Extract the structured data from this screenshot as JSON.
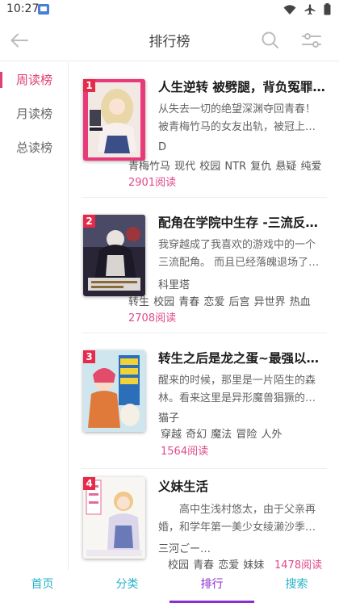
{
  "status_bar": {
    "time": "10:27"
  },
  "header": {
    "title": "排行榜"
  },
  "sidebar": {
    "items": [
      {
        "label": "周读榜",
        "active": true
      },
      {
        "label": "月读榜",
        "active": false
      },
      {
        "label": "总读榜",
        "active": false
      }
    ]
  },
  "list": [
    {
      "rank": "1",
      "title": "人生逆转 被劈腿，背负冤罪…",
      "desc": "从失去一切的绝望深渊夺回青春！被青梅竹马的女友出轨，被冠上…",
      "author": "D",
      "tags": "青梅竹马 现代 校园 NTR 复仇 悬疑 纯爱",
      "reads": "2901阅读"
    },
    {
      "rank": "2",
      "title": "配角在学院中生存 -三流反…",
      "desc": "我穿越成了我喜欢的游戏中的一个三流配角。 而且已经落魄退场了…",
      "author": "科里塔",
      "tags": "转生 校园 青春 恋爱 后宫 异世界 热血",
      "reads": "2708阅读"
    },
    {
      "rank": "3",
      "title": "转生之后是龙之蛋~最强以…",
      "desc": "醒来的时候，那里是一片陌生的森林。看来这里是异形魔兽猖獗的…",
      "author": "猫子",
      "tags": "穿越 奇幻 魔法 冒险 人外",
      "reads": "1564阅读"
    },
    {
      "rank": "4",
      "title": "义妹生活",
      "desc": "　　高中生浅村悠太，由于父亲再婚，和学年第一美少女绫濑沙季…",
      "author": "三河ごー…",
      "tags": "校园 青春 恋爱 妹妹",
      "reads": "1478阅读"
    }
  ],
  "bottom_nav": {
    "tabs": [
      {
        "label": "首页",
        "active": false
      },
      {
        "label": "分类",
        "active": false
      },
      {
        "label": "排行",
        "active": true
      },
      {
        "label": "搜索",
        "active": false
      }
    ]
  },
  "colors": {
    "accent_pink": "#e04070",
    "read_count": "#e04a8a",
    "rank_badge": "#e52a4a",
    "nav_text": "#27b2c8",
    "nav_active": "#8a2ed0"
  }
}
